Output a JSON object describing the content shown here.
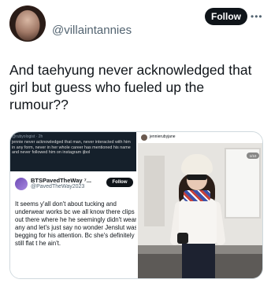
{
  "author": {
    "username": "@villaintannies",
    "follow_label": "Follow",
    "more_icon": "more-dots-icon"
  },
  "tweet": {
    "text": "And taehyung never acknowledged that girl but guess who fueled up the rumour??"
  },
  "media": {
    "left_screenshot": {
      "meta": "@rubyologist · 2h",
      "text": "jennie never acknowledged that man, never interacted with him in any form, never in her whole career has mentioned his name and never followed him on instagram ijbol",
      "quoted": {
        "name": "BTSPavedTheWay ⁷...",
        "handle": "@PavedTheWay2023",
        "follow_label": "Follow",
        "body": "It seems y'all don't about tucking and underwear works bc we all know there clips out there where he he seemingly didn't wear any and let's just say no wonder Jenslut was begging for his attention. Bc she's definitely still flat t he ain't."
      }
    },
    "right_photo": {
      "account": "jennierubyjane",
      "counter": "1/10"
    }
  }
}
